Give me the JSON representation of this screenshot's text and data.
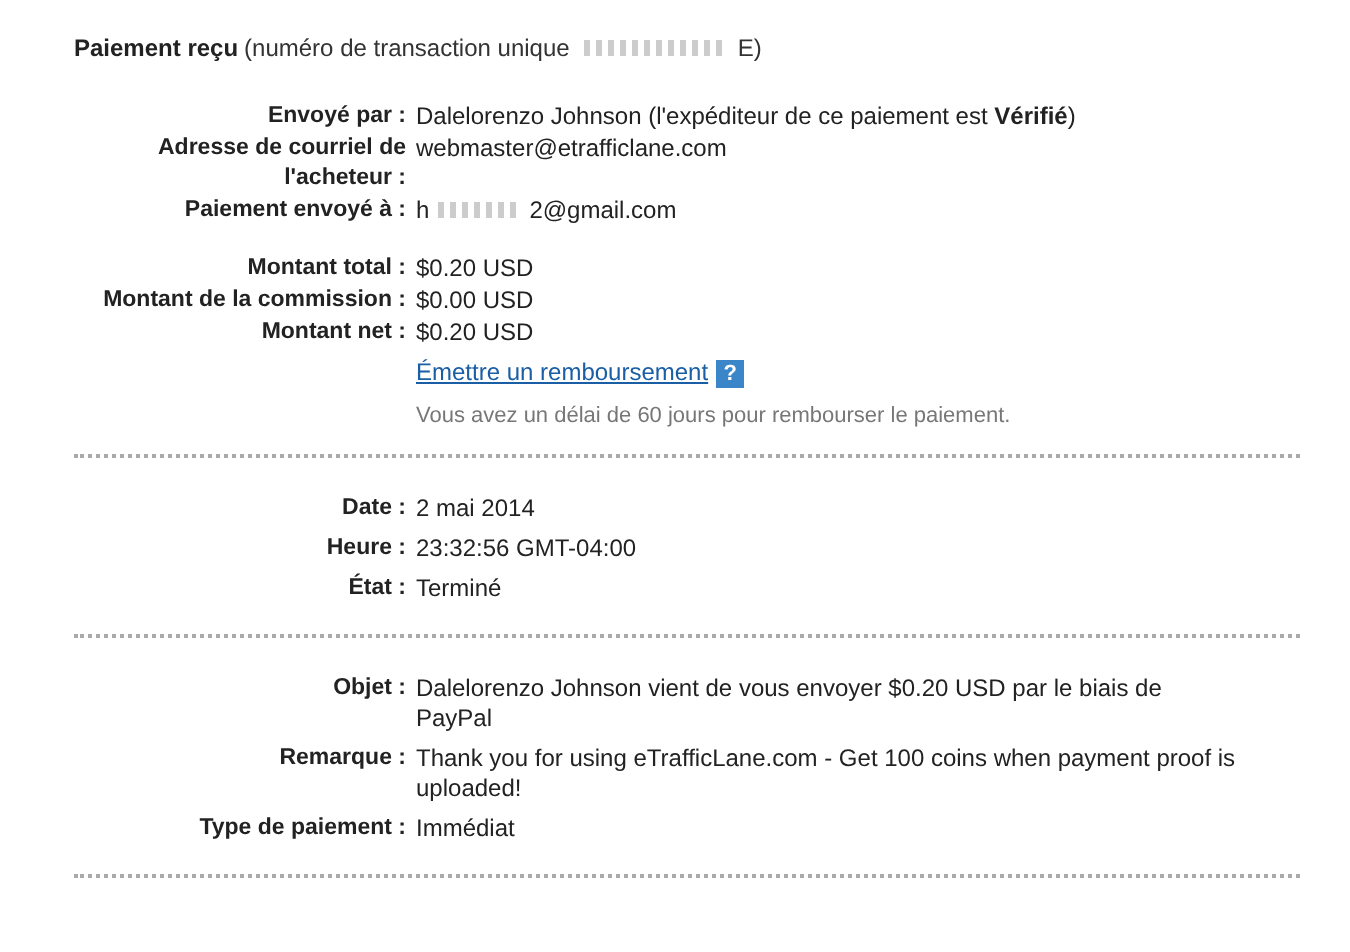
{
  "header": {
    "title": "Paiement reçu",
    "detail_before": "(numéro de transaction unique",
    "detail_after": "E)"
  },
  "sections": [
    {
      "groups": [
        {
          "rows": [
            {
              "kind": "field",
              "label": "Envoyé par :",
              "value": "Dalelorenzo Johnson (l'expéditeur de ce paiement est **Vérifié**)"
            },
            {
              "kind": "field",
              "label": "Adresse de courriel de l'acheteur :",
              "value": "webmaster@etrafficlane.com"
            },
            {
              "kind": "redacted",
              "label": "Paiement envoyé à :",
              "before": "h",
              "after": "2@gmail.com"
            }
          ]
        },
        {
          "rows": [
            {
              "kind": "field",
              "label": "Montant total :",
              "value": "$0.20 USD"
            },
            {
              "kind": "field",
              "label": "Montant de la commission :",
              "value": "$0.00 USD"
            },
            {
              "kind": "field",
              "label": "Montant net :",
              "value": "$0.20 USD"
            },
            {
              "kind": "link",
              "text": "Émettre un remboursement",
              "help": "?"
            },
            {
              "kind": "note",
              "text": "Vous avez un délai de 60 jours pour rembourser le paiement."
            }
          ]
        }
      ]
    },
    {
      "groups": [
        {
          "rows": [
            {
              "kind": "field",
              "label": "Date :",
              "value": "2 mai 2014"
            },
            {
              "kind": "field",
              "label": "Heure :",
              "value": "23:32:56 GMT-04:00"
            },
            {
              "kind": "field",
              "label": "État :",
              "value": "Terminé"
            }
          ]
        }
      ]
    },
    {
      "groups": [
        {
          "rows": [
            {
              "kind": "field",
              "label": "Objet :",
              "value": "Dalelorenzo Johnson vient de vous envoyer $0.20 USD par le biais de PayPal"
            },
            {
              "kind": "field",
              "label": "Remarque :",
              "value": "Thank you for using eTrafficLane.com - Get 100 coins when payment proof is uploaded!"
            },
            {
              "kind": "field",
              "label": "Type de paiement :",
              "value": "Immédiat"
            }
          ]
        }
      ]
    }
  ]
}
